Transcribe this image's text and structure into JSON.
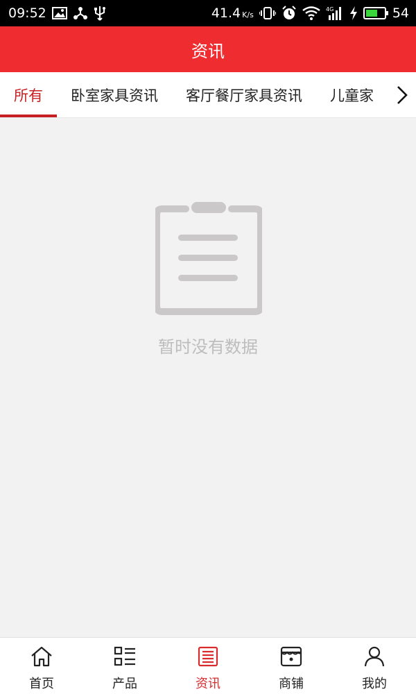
{
  "status_bar": {
    "time": "09:52",
    "network_speed": "41.4",
    "network_speed_unit": "K/s",
    "signal_label": "4G",
    "battery": "54",
    "icons": [
      "image-icon",
      "share-icon",
      "usb-icon",
      "vibrate-icon",
      "alarm-icon",
      "wifi-icon",
      "signal-icon",
      "charging-icon",
      "battery-icon"
    ]
  },
  "header": {
    "title": "资讯"
  },
  "tabs": {
    "items": [
      {
        "label": "所有",
        "active": true
      },
      {
        "label": "卧室家具资讯",
        "active": false
      },
      {
        "label": "客厅餐厅家具资讯",
        "active": false
      },
      {
        "label": "儿童家",
        "active": false
      }
    ],
    "scroll_icon": "chevron-right-icon"
  },
  "empty_state": {
    "icon": "clipboard-icon",
    "message": "暂时没有数据"
  },
  "bottom_nav": {
    "items": [
      {
        "label": "首页",
        "icon": "home-icon",
        "active": false
      },
      {
        "label": "产品",
        "icon": "grid-list-icon",
        "active": false
      },
      {
        "label": "资讯",
        "icon": "news-icon",
        "active": true
      },
      {
        "label": "商铺",
        "icon": "store-icon",
        "active": false
      },
      {
        "label": "我的",
        "icon": "user-icon",
        "active": false
      }
    ]
  },
  "colors": {
    "brand_red": "#ef2d31",
    "active_red": "#c71f21",
    "empty_text": "#bdbdbd",
    "background": "#f2f2f2"
  }
}
